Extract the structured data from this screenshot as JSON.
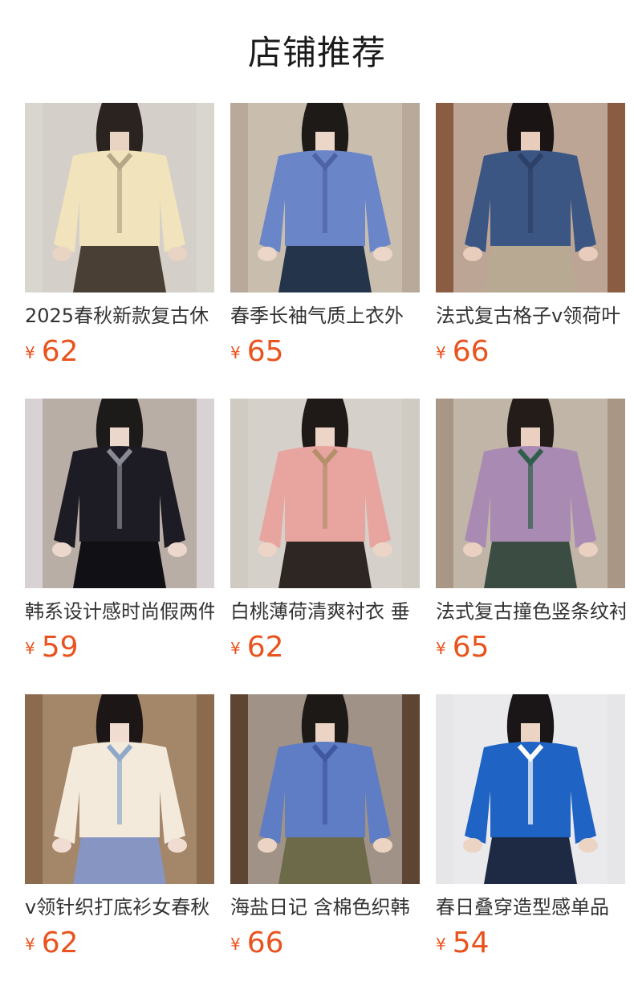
{
  "header": {
    "title": "店铺推荐"
  },
  "currency_symbol": "¥",
  "products": [
    {
      "name": "2025春秋新款复古休",
      "price": "62",
      "image": {
        "bg": "#d9d6cf",
        "wall": "#cfcbc2",
        "top": "#f1e4bd",
        "bottom": "#4a3f35",
        "accent": "#b5a785",
        "skin": "#e9d3c3",
        "hair": "#2a2320"
      }
    },
    {
      "name": "春季长袖气质上衣外",
      "price": "65",
      "image": {
        "bg": "#b9a99a",
        "wall": "#d7cdc0",
        "top": "#6a86c9",
        "bottom": "#24344a",
        "accent": "#4e63a3",
        "skin": "#ecd6c8",
        "hair": "#1e1a18"
      }
    },
    {
      "name": "法式复古格子v领荷叶",
      "price": "66",
      "image": {
        "bg": "#8a5c42",
        "wall": "#e6e1d8",
        "top": "#3b5683",
        "bottom": "#b8aa92",
        "accent": "#2c4068",
        "skin": "#e8cdbc",
        "hair": "#1a1514"
      }
    },
    {
      "name": "韩系设计感时尚假两件",
      "price": "59",
      "image": {
        "bg": "#d8d2d4",
        "wall": "#a08f7e",
        "top": "#1d1b24",
        "bottom": "#111014",
        "accent": "#8a8a96",
        "skin": "#ecd7cc",
        "hair": "#1d1a1a"
      }
    },
    {
      "name": "白桃薄荷清爽衬衣 垂",
      "price": "62",
      "image": {
        "bg": "#cfcac2",
        "wall": "#dbd6cf",
        "top": "#e8a5a0",
        "bottom": "#2e2622",
        "accent": "#b58f6a",
        "skin": "#ecd5c6",
        "hair": "#1f1a18"
      }
    },
    {
      "name": "法式复古撞色竖条纹衬",
      "price": "65",
      "image": {
        "bg": "#a99684",
        "wall": "#d6cfc6",
        "top": "#a88ab3",
        "bottom": "#3b4d42",
        "accent": "#2f5e4a",
        "skin": "#e9d0c0",
        "hair": "#231c19"
      }
    },
    {
      "name": "v领针织打底衫女春秋",
      "price": "62",
      "image": {
        "bg": "#8b6a4e",
        "wall": "#b99c80",
        "top": "#f3eadc",
        "bottom": "#8795c2",
        "accent": "#8ea8c8",
        "skin": "#f0dcd0",
        "hair": "#1c1716"
      }
    },
    {
      "name": "海盐日记 含棉色织韩",
      "price": "66",
      "image": {
        "bg": "#5e4432",
        "wall": "#d7d3cc",
        "top": "#5f7dc4",
        "bottom": "#6d6a4a",
        "accent": "#3f58a0",
        "skin": "#ecd4c4",
        "hair": "#1d1917"
      }
    },
    {
      "name": "春日叠穿造型感单品",
      "price": "54",
      "image": {
        "bg": "#e6e6e8",
        "wall": "#ededee",
        "top": "#1f63c4",
        "bottom": "#1e2a44",
        "accent": "#ffffff",
        "skin": "#ecd4c4",
        "hair": "#1a1617"
      }
    }
  ]
}
